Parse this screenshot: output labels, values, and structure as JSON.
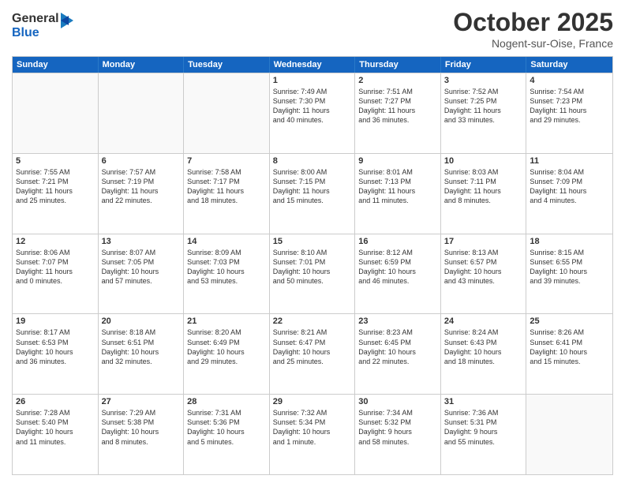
{
  "header": {
    "logo_general": "General",
    "logo_blue": "Blue",
    "month_title": "October 2025",
    "location": "Nogent-sur-Oise, France"
  },
  "weekdays": [
    "Sunday",
    "Monday",
    "Tuesday",
    "Wednesday",
    "Thursday",
    "Friday",
    "Saturday"
  ],
  "rows": [
    [
      {
        "day": "",
        "text": "",
        "empty": true
      },
      {
        "day": "",
        "text": "",
        "empty": true
      },
      {
        "day": "",
        "text": "",
        "empty": true
      },
      {
        "day": "1",
        "text": "Sunrise: 7:49 AM\nSunset: 7:30 PM\nDaylight: 11 hours\nand 40 minutes."
      },
      {
        "day": "2",
        "text": "Sunrise: 7:51 AM\nSunset: 7:27 PM\nDaylight: 11 hours\nand 36 minutes."
      },
      {
        "day": "3",
        "text": "Sunrise: 7:52 AM\nSunset: 7:25 PM\nDaylight: 11 hours\nand 33 minutes."
      },
      {
        "day": "4",
        "text": "Sunrise: 7:54 AM\nSunset: 7:23 PM\nDaylight: 11 hours\nand 29 minutes."
      }
    ],
    [
      {
        "day": "5",
        "text": "Sunrise: 7:55 AM\nSunset: 7:21 PM\nDaylight: 11 hours\nand 25 minutes."
      },
      {
        "day": "6",
        "text": "Sunrise: 7:57 AM\nSunset: 7:19 PM\nDaylight: 11 hours\nand 22 minutes."
      },
      {
        "day": "7",
        "text": "Sunrise: 7:58 AM\nSunset: 7:17 PM\nDaylight: 11 hours\nand 18 minutes."
      },
      {
        "day": "8",
        "text": "Sunrise: 8:00 AM\nSunset: 7:15 PM\nDaylight: 11 hours\nand 15 minutes."
      },
      {
        "day": "9",
        "text": "Sunrise: 8:01 AM\nSunset: 7:13 PM\nDaylight: 11 hours\nand 11 minutes."
      },
      {
        "day": "10",
        "text": "Sunrise: 8:03 AM\nSunset: 7:11 PM\nDaylight: 11 hours\nand 8 minutes."
      },
      {
        "day": "11",
        "text": "Sunrise: 8:04 AM\nSunset: 7:09 PM\nDaylight: 11 hours\nand 4 minutes."
      }
    ],
    [
      {
        "day": "12",
        "text": "Sunrise: 8:06 AM\nSunset: 7:07 PM\nDaylight: 11 hours\nand 0 minutes."
      },
      {
        "day": "13",
        "text": "Sunrise: 8:07 AM\nSunset: 7:05 PM\nDaylight: 10 hours\nand 57 minutes."
      },
      {
        "day": "14",
        "text": "Sunrise: 8:09 AM\nSunset: 7:03 PM\nDaylight: 10 hours\nand 53 minutes."
      },
      {
        "day": "15",
        "text": "Sunrise: 8:10 AM\nSunset: 7:01 PM\nDaylight: 10 hours\nand 50 minutes."
      },
      {
        "day": "16",
        "text": "Sunrise: 8:12 AM\nSunset: 6:59 PM\nDaylight: 10 hours\nand 46 minutes."
      },
      {
        "day": "17",
        "text": "Sunrise: 8:13 AM\nSunset: 6:57 PM\nDaylight: 10 hours\nand 43 minutes."
      },
      {
        "day": "18",
        "text": "Sunrise: 8:15 AM\nSunset: 6:55 PM\nDaylight: 10 hours\nand 39 minutes."
      }
    ],
    [
      {
        "day": "19",
        "text": "Sunrise: 8:17 AM\nSunset: 6:53 PM\nDaylight: 10 hours\nand 36 minutes."
      },
      {
        "day": "20",
        "text": "Sunrise: 8:18 AM\nSunset: 6:51 PM\nDaylight: 10 hours\nand 32 minutes."
      },
      {
        "day": "21",
        "text": "Sunrise: 8:20 AM\nSunset: 6:49 PM\nDaylight: 10 hours\nand 29 minutes."
      },
      {
        "day": "22",
        "text": "Sunrise: 8:21 AM\nSunset: 6:47 PM\nDaylight: 10 hours\nand 25 minutes."
      },
      {
        "day": "23",
        "text": "Sunrise: 8:23 AM\nSunset: 6:45 PM\nDaylight: 10 hours\nand 22 minutes."
      },
      {
        "day": "24",
        "text": "Sunrise: 8:24 AM\nSunset: 6:43 PM\nDaylight: 10 hours\nand 18 minutes."
      },
      {
        "day": "25",
        "text": "Sunrise: 8:26 AM\nSunset: 6:41 PM\nDaylight: 10 hours\nand 15 minutes."
      }
    ],
    [
      {
        "day": "26",
        "text": "Sunrise: 7:28 AM\nSunset: 5:40 PM\nDaylight: 10 hours\nand 11 minutes."
      },
      {
        "day": "27",
        "text": "Sunrise: 7:29 AM\nSunset: 5:38 PM\nDaylight: 10 hours\nand 8 minutes."
      },
      {
        "day": "28",
        "text": "Sunrise: 7:31 AM\nSunset: 5:36 PM\nDaylight: 10 hours\nand 5 minutes."
      },
      {
        "day": "29",
        "text": "Sunrise: 7:32 AM\nSunset: 5:34 PM\nDaylight: 10 hours\nand 1 minute."
      },
      {
        "day": "30",
        "text": "Sunrise: 7:34 AM\nSunset: 5:32 PM\nDaylight: 9 hours\nand 58 minutes."
      },
      {
        "day": "31",
        "text": "Sunrise: 7:36 AM\nSunset: 5:31 PM\nDaylight: 9 hours\nand 55 minutes."
      },
      {
        "day": "",
        "text": "",
        "empty": true
      }
    ]
  ]
}
